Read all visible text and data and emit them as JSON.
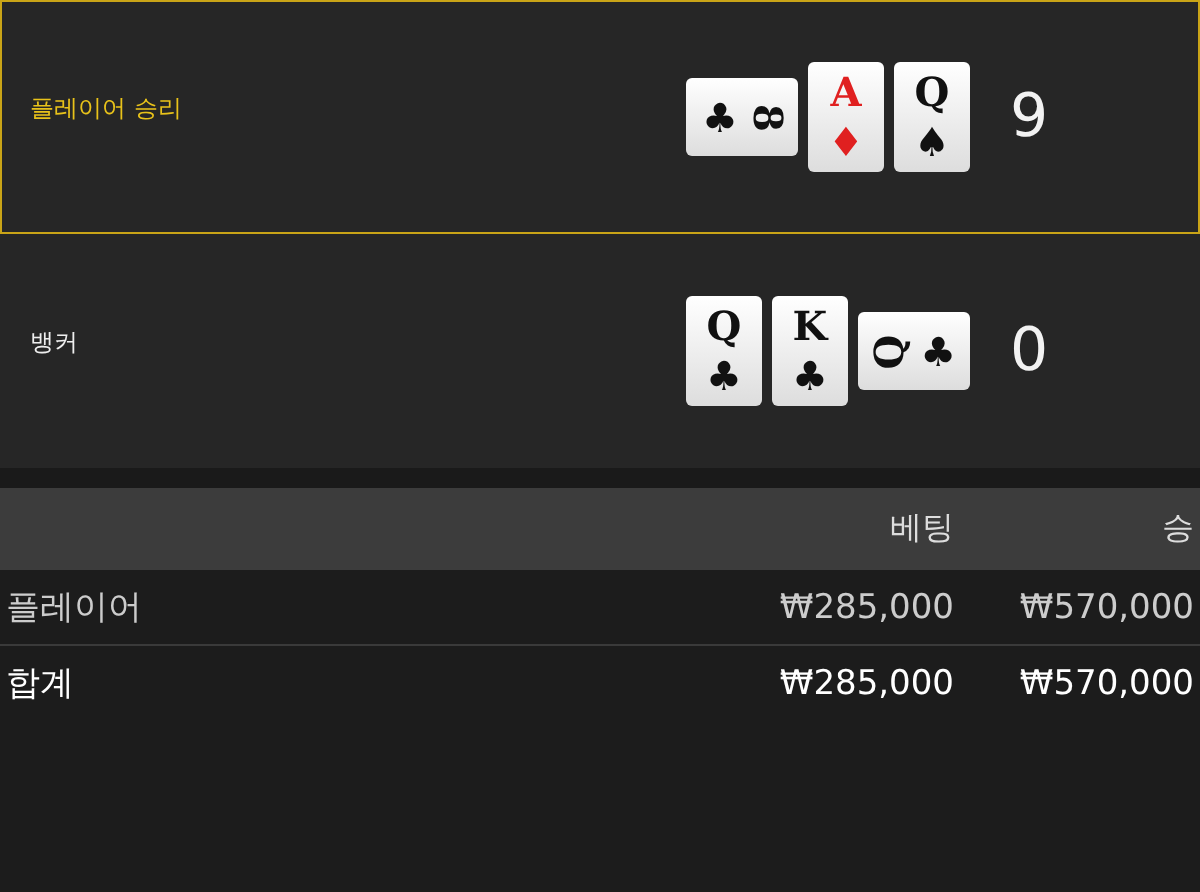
{
  "hands": [
    {
      "name": "플레이어 승리",
      "winner": true,
      "score": "9",
      "cards": [
        {
          "kind": "turned_right",
          "rank": "8",
          "suit": "♣",
          "color": "#111111"
        },
        {
          "kind": "upright",
          "rank": "A",
          "suit": "♦",
          "color": "#e02020"
        },
        {
          "kind": "upright",
          "rank": "Q",
          "suit": "♠",
          "color": "#111111"
        }
      ]
    },
    {
      "name": "뱅커",
      "winner": false,
      "score": "0",
      "cards": [
        {
          "kind": "upright",
          "rank": "Q",
          "suit": "♣",
          "color": "#111111"
        },
        {
          "kind": "upright",
          "rank": "K",
          "suit": "♣",
          "color": "#111111"
        },
        {
          "kind": "turned_left",
          "rank": "Q",
          "suit": "♣",
          "color": "#111111"
        }
      ]
    }
  ],
  "table": {
    "columns": [
      "",
      "베팅",
      "승"
    ],
    "rows": [
      {
        "kind": "bet",
        "cells": [
          "플레이어",
          "₩285,000",
          "₩570,000"
        ]
      },
      {
        "kind": "total",
        "cells": [
          "합계",
          "₩285,000",
          "₩570,000"
        ]
      }
    ]
  }
}
